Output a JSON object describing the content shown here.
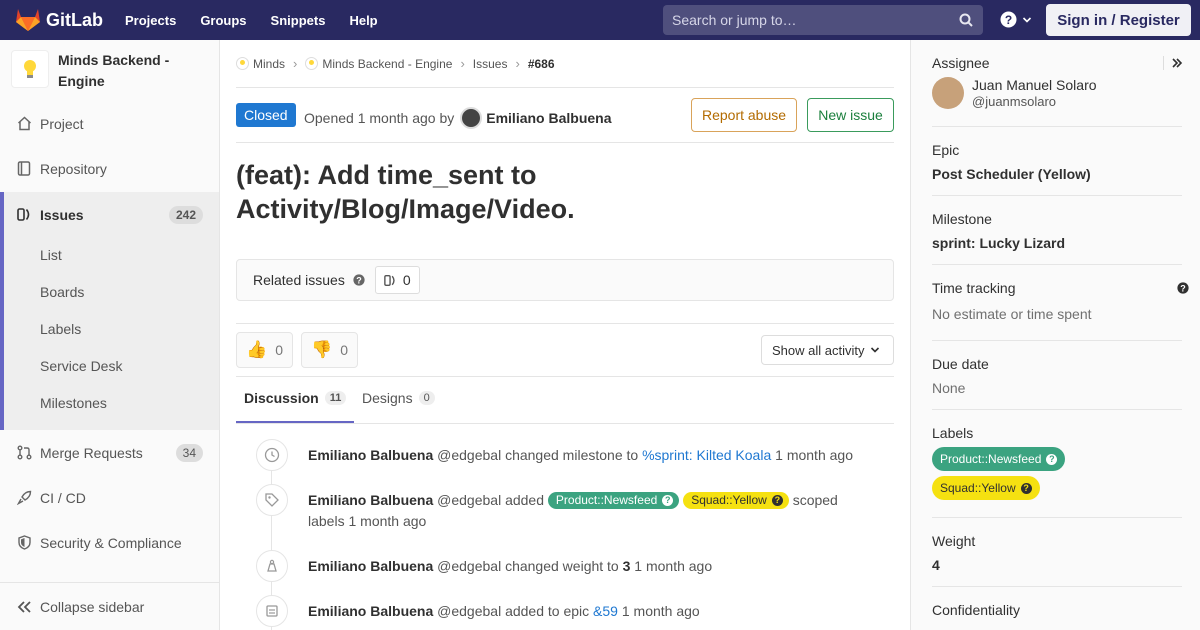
{
  "navbar": {
    "brand": "GitLab",
    "links": [
      "Projects",
      "Groups",
      "Snippets",
      "Help"
    ],
    "search_placeholder": "Search or jump to…",
    "signin": "Sign in / Register"
  },
  "sidebar": {
    "project_name": "Minds Backend - Engine",
    "items": [
      {
        "label": "Project",
        "icon": "home-icon"
      },
      {
        "label": "Repository",
        "icon": "book-icon"
      },
      {
        "label": "Issues",
        "icon": "issues-icon",
        "badge": "242"
      },
      {
        "label": "Merge Requests",
        "icon": "merge-request-icon",
        "badge": "34"
      },
      {
        "label": "CI / CD",
        "icon": "rocket-icon"
      },
      {
        "label": "Security & Compliance",
        "icon": "shield-icon"
      }
    ],
    "issues_subitems": [
      "List",
      "Boards",
      "Labels",
      "Service Desk",
      "Milestones"
    ],
    "collapse": "Collapse sidebar"
  },
  "breadcrumb": [
    "Minds",
    "Minds Backend - Engine",
    "Issues",
    "#686"
  ],
  "issue": {
    "status": "Closed",
    "opened_prefix": "Opened",
    "opened_time": "1 month ago",
    "by": "by",
    "author": "Emiliano Balbuena",
    "title": "(feat): Add time_sent to Activity/Blog/Image/Video.",
    "report_abuse": "Report abuse",
    "new_issue": "New issue"
  },
  "related": {
    "label": "Related issues",
    "count": "0"
  },
  "awards": {
    "thumbsup": "0",
    "thumbsdown": "0"
  },
  "activity_filter": "Show all activity",
  "tabs": [
    {
      "label": "Discussion",
      "count": "11"
    },
    {
      "label": "Designs",
      "count": "0"
    }
  ],
  "timeline": [
    {
      "who": "Emiliano Balbuena",
      "handle": "@edgebal",
      "action": "changed milestone to",
      "link": "%sprint: Kilted Koala",
      "time": "1 month ago",
      "icon": "clock-icon"
    },
    {
      "who": "Emiliano Balbuena",
      "handle": "@edgebal",
      "action": "added",
      "labels": [
        "Product::Newsfeed",
        "Squad::Yellow"
      ],
      "suffix": "scoped labels",
      "time": "1 month ago",
      "icon": "tag-icon"
    },
    {
      "who": "Emiliano Balbuena",
      "handle": "@edgebal",
      "action": "changed weight to",
      "value": "3",
      "time": "1 month ago",
      "icon": "weight-icon"
    },
    {
      "who": "Emiliano Balbuena",
      "handle": "@edgebal",
      "action": "added to epic",
      "link": "&59",
      "time": "1 month ago",
      "icon": "epic-icon"
    }
  ],
  "right_sidebar": {
    "assignee_title": "Assignee",
    "assignee_name": "Juan Manuel Solaro",
    "assignee_handle": "@juanmsolaro",
    "epic_title": "Epic",
    "epic_value": "Post Scheduler (Yellow)",
    "milestone_title": "Milestone",
    "milestone_value": "sprint: Lucky Lizard",
    "time_title": "Time tracking",
    "time_value": "No estimate or time spent",
    "due_title": "Due date",
    "due_value": "None",
    "labels_title": "Labels",
    "labels": [
      "Product::Newsfeed",
      "Squad::Yellow"
    ],
    "weight_title": "Weight",
    "weight_value": "4",
    "confidentiality_title": "Confidentiality"
  },
  "colors": {
    "navbar": "#292961",
    "accent": "#6666c4",
    "closed": "#1f78d1",
    "label_newsfeed": "#3ba380",
    "label_yellow": "#f5e111"
  }
}
